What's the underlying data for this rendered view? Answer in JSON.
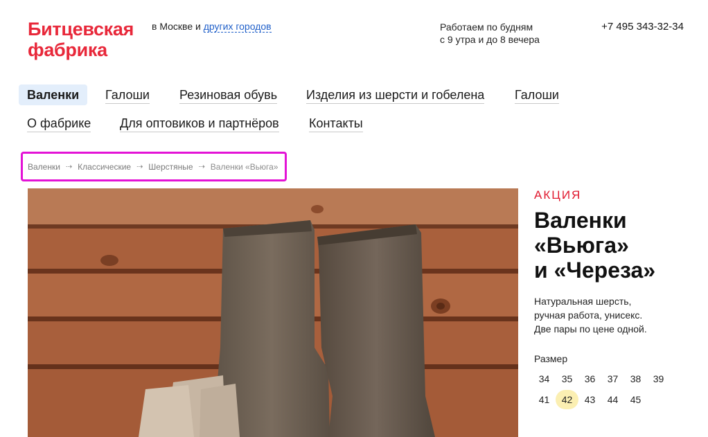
{
  "header": {
    "logo_line1": "Битцевская",
    "logo_line2": "фабрика",
    "city_prefix": "в Москве и ",
    "city_link": "других городов",
    "hours_line1": "Работаем по будням",
    "hours_line2": "с 9 утра и до 8 вечера",
    "phone": "+7 495 343-32-34"
  },
  "nav": {
    "row1": [
      "Валенки",
      "Галоши",
      "Резиновая обувь",
      "Изделия из шерсти и гобелена",
      "Галоши"
    ],
    "row2": [
      "О фабрике",
      "Для оптовиков и партнёров",
      "Контакты"
    ],
    "active": "Валенки"
  },
  "breadcrumbs": [
    "Валенки",
    "Классические",
    "Шерстяные",
    "Валенки «Вьюга»"
  ],
  "breadcrumb_separator": "⇢",
  "promo": {
    "label": "АКЦИЯ",
    "title_line1": "Валенки",
    "title_line2": "«Вьюга»",
    "title_line3": "и «Череза»",
    "desc_line1": "Натуральная шерсть,",
    "desc_line2": "ручная работа, унисекс.",
    "desc_line3": "Две пары по цене одной.",
    "size_label": "Размер",
    "sizes_row1": [
      "34",
      "35",
      "36",
      "37",
      "38",
      "39"
    ],
    "sizes_row2": [
      "41",
      "42",
      "43",
      "44",
      "45"
    ],
    "selected_size": "42"
  },
  "colors": {
    "brand": "#e8283a",
    "link": "#1f5fc9",
    "active_nav_bg": "#e3eefb",
    "selected_size_bg": "#fbefb2",
    "highlight_border": "#e313d6"
  }
}
